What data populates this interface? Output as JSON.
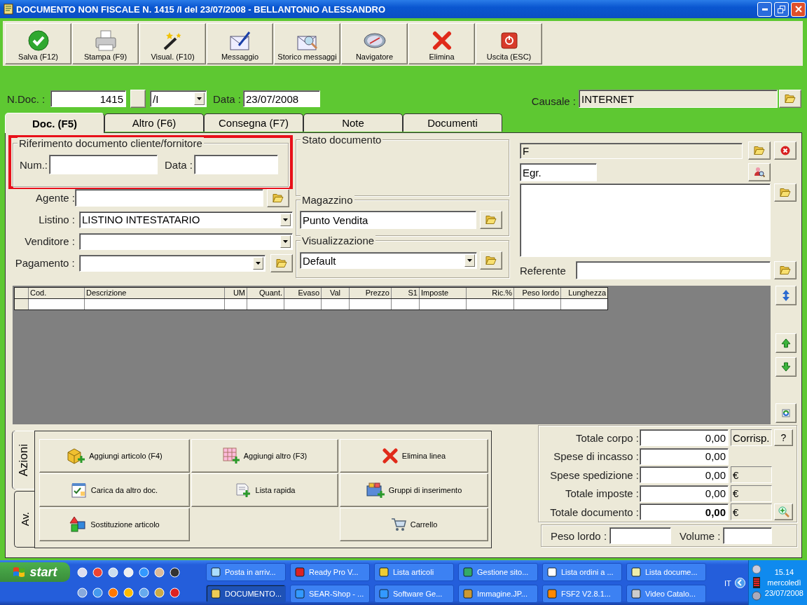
{
  "window": {
    "title": "DOCUMENTO NON FISCALE N. 1415 /I del 23/07/2008 - BELLANTONIO ALESSANDRO"
  },
  "toolbar": [
    {
      "label": "Salva (F12)"
    },
    {
      "label": "Stampa (F9)"
    },
    {
      "label": "Visual. (F10)"
    },
    {
      "label": "Messaggio"
    },
    {
      "label": "Storico messaggi"
    },
    {
      "label": "Navigatore"
    },
    {
      "label": "Elimina"
    },
    {
      "label": "Uscita (ESC)"
    }
  ],
  "header": {
    "ndoc_label": "N.Doc. :",
    "ndoc_value": "1415",
    "series_value": "/I",
    "data_label": "Data :",
    "data_value": "23/07/2008",
    "causale_label": "Causale :",
    "causale_value": "INTERNET"
  },
  "tabs": [
    {
      "label": "Doc. (F5)",
      "selected": true
    },
    {
      "label": "Altro (F6)",
      "selected": false
    },
    {
      "label": "Consegna (F7)",
      "selected": false
    },
    {
      "label": "Note",
      "selected": false
    },
    {
      "label": "Documenti",
      "selected": false
    }
  ],
  "riferimento": {
    "title": "Riferimento documento cliente/fornitore",
    "num_label": "Num.:",
    "data_label": "Data :"
  },
  "fields": [
    {
      "label": "Agente :",
      "kind": "input-folder"
    },
    {
      "label": "Listino :",
      "value": "LISTINO INTESTATARIO",
      "kind": "dropdown"
    },
    {
      "label": "Venditore :",
      "kind": "dropdown"
    },
    {
      "label": "Pagamento :",
      "kind": "dropdown-folder"
    }
  ],
  "stato_documento": {
    "title": "Stato documento"
  },
  "magazzino": {
    "title": "Magazzino",
    "value": "Punto Vendita"
  },
  "visualizzazione": {
    "title": "Visualizzazione",
    "value": "Default"
  },
  "customer": {
    "name_value": "F",
    "salutation": "Egr.",
    "referente_label": "Referente"
  },
  "table": {
    "columns": [
      {
        "label": "Cod."
      },
      {
        "label": "Descrizione"
      },
      {
        "label": "UM"
      },
      {
        "label": "Quant."
      },
      {
        "label": "Evaso"
      },
      {
        "label": "Val"
      },
      {
        "label": "Prezzo"
      },
      {
        "label": "S1"
      },
      {
        "label": "Imposte"
      },
      {
        "label": "Ric.%"
      },
      {
        "label": "Peso lordo"
      },
      {
        "label": "Lunghezza"
      }
    ]
  },
  "actions": {
    "side_tabs": [
      {
        "label": "Azioni",
        "selected": true
      },
      {
        "label": "Av.",
        "selected": false
      }
    ],
    "rows": [
      [
        {
          "label": "Aggiungi articolo (F4)"
        },
        {
          "label": "Aggiungi altro (F3)"
        },
        {
          "label": "Elimina linea"
        }
      ],
      [
        {
          "label": "Carica da altro doc."
        },
        {
          "label": "Lista rapida"
        },
        {
          "label": "Gruppi di inserimento"
        }
      ],
      [
        {
          "label": "Sostituzione articolo"
        },
        null,
        {
          "label": "Carrello"
        }
      ]
    ]
  },
  "totals": [
    {
      "label": "Totale corpo :",
      "value": "0,00",
      "unit": "Corrisp.",
      "button": "?",
      "kind": "text-button",
      "bold": false
    },
    {
      "label": "Spese di incasso :",
      "value": "0,00",
      "kind": "plain",
      "bold": false
    },
    {
      "label": "Spese spedizione :",
      "value": "0,00",
      "unit": "€",
      "kind": "plain",
      "bold": false
    },
    {
      "label": "Totale imposte :",
      "value": "0,00",
      "unit": "€",
      "kind": "plain",
      "bold": false
    },
    {
      "label": "Totale documento :",
      "value": "0,00",
      "unit": "€",
      "kind": "zoom-button",
      "bold": true
    }
  ],
  "weights": {
    "peso_label": "Peso lordo :",
    "volume_label": "Volume :"
  },
  "taskbar": {
    "start": "start",
    "tasks": [
      {
        "label": "Posta in arriv...",
        "selected": false
      },
      {
        "label": "Ready Pro V...",
        "selected": false
      },
      {
        "label": "Lista articoli",
        "selected": false
      },
      {
        "label": "Gestione sito...",
        "selected": false
      },
      {
        "label": "Lista ordini a ...",
        "selected": false
      },
      {
        "label": "Lista docume...",
        "selected": false
      },
      {
        "label": "DOCUMENTO...",
        "selected": true
      },
      {
        "label": "SEAR-Shop - ...",
        "selected": false
      },
      {
        "label": "Software Ge...",
        "selected": false
      },
      {
        "label": "Immagine.JP...",
        "selected": false
      },
      {
        "label": "FSF2 V2.8.1...",
        "selected": false
      },
      {
        "label": "Video Catalo...",
        "selected": false
      }
    ],
    "language": "IT",
    "clock": {
      "time": "15.14",
      "day": "mercoledì",
      "date": "23/07/2008"
    }
  }
}
